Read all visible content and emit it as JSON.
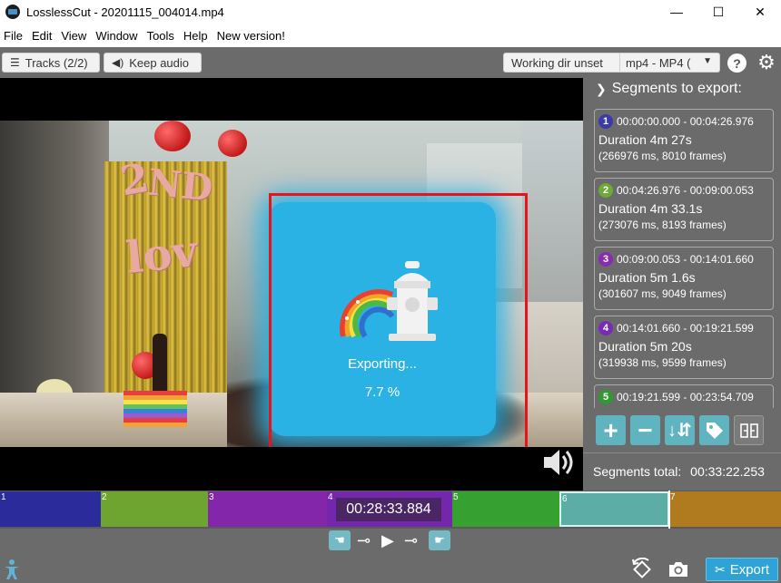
{
  "window": {
    "title": "LosslessCut - 20201115_004014.mp4",
    "minimize": "—",
    "maximize": "☐",
    "close": "✕"
  },
  "menu": [
    "File",
    "Edit",
    "View",
    "Window",
    "Tools",
    "Help",
    "New version!"
  ],
  "toolbar": {
    "tracks_label": "Tracks (2/2)",
    "keep_audio_label": "Keep audio",
    "working_dir_label": "Working dir unset",
    "format_label": "mp4 - MP4 (",
    "help_label": "?"
  },
  "export_overlay": {
    "label": "Exporting...",
    "progress_text": "7.7 %",
    "progress": 0.077,
    "color": "#2ab2e5"
  },
  "sidebar": {
    "title": "Segments to export:",
    "segments": [
      {
        "num": "1",
        "range": "00:00:00.000 - 00:04:26.976",
        "duration": "Duration 4m 27s",
        "meta": "(266976 ms, 8010 frames)",
        "color": "#3a3aa8"
      },
      {
        "num": "2",
        "range": "00:04:26.976 - 00:09:00.053",
        "duration": "Duration 4m 33.1s",
        "meta": "(273076 ms, 8193 frames)",
        "color": "#6fa93a"
      },
      {
        "num": "3",
        "range": "00:09:00.053 - 00:14:01.660",
        "duration": "Duration 5m 1.6s",
        "meta": "(301607 ms, 9049 frames)",
        "color": "#8a2bb0"
      },
      {
        "num": "4",
        "range": "00:14:01.660 - 00:19:21.599",
        "duration": "Duration 5m 20s",
        "meta": "(319938 ms, 9599 frames)",
        "color": "#7a2ab8"
      },
      {
        "num": "5",
        "range": "00:19:21.599 - 00:23:54.709",
        "duration": "",
        "meta": "",
        "color": "#2f9a2f"
      }
    ],
    "total_label": "Segments total:",
    "total_value": "00:33:22.253",
    "actions": {
      "add": "+",
      "remove": "−",
      "sort": "↓",
      "tag": "",
      "split": ""
    }
  },
  "timeline": {
    "current_time": "00:28:33.884",
    "segments": [
      {
        "num": "1",
        "color": "#2b2b9c"
      },
      {
        "num": "2",
        "color": "#6ea531"
      },
      {
        "num": "3",
        "color": "#8326aa"
      },
      {
        "num": "4",
        "color": "#7426ad"
      },
      {
        "num": "5",
        "color": "#36a030"
      },
      {
        "num": "6",
        "color": "#5bada6"
      },
      {
        "num": "7",
        "color": "#b07a1e"
      }
    ]
  },
  "bottom": {
    "export_label": "Export"
  }
}
